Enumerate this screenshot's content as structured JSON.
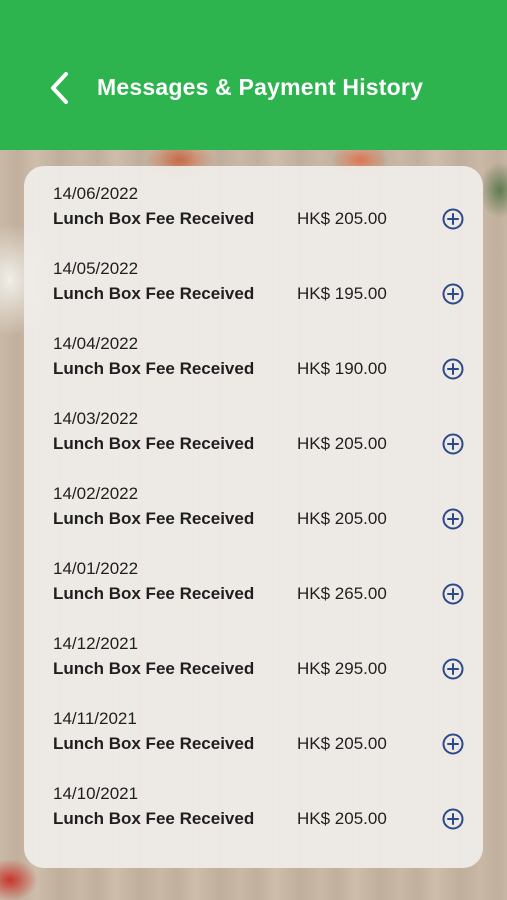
{
  "header": {
    "title": "Messages & Payment History",
    "back_icon": "chevron-left-icon",
    "color": "#2db44f"
  },
  "payments": [
    {
      "date": "14/06/2022",
      "description": "Lunch Box Fee Received",
      "amount": "HK$ 205.00"
    },
    {
      "date": "14/05/2022",
      "description": "Lunch Box Fee Received",
      "amount": "HK$ 195.00"
    },
    {
      "date": "14/04/2022",
      "description": "Lunch Box Fee Received",
      "amount": "HK$ 190.00"
    },
    {
      "date": "14/03/2022",
      "description": "Lunch Box Fee Received",
      "amount": "HK$ 205.00"
    },
    {
      "date": "14/02/2022",
      "description": "Lunch Box Fee Received",
      "amount": "HK$ 205.00"
    },
    {
      "date": "14/01/2022",
      "description": "Lunch Box Fee Received",
      "amount": "HK$ 265.00"
    },
    {
      "date": "14/12/2021",
      "description": "Lunch Box Fee Received",
      "amount": "HK$ 295.00"
    },
    {
      "date": "14/11/2021",
      "description": "Lunch Box Fee Received",
      "amount": "HK$ 205.00"
    },
    {
      "date": "14/10/2021",
      "description": "Lunch Box Fee Received",
      "amount": "HK$ 205.00"
    }
  ],
  "expand_icon": "plus-circle-icon",
  "icon_color": "#2c4a8a"
}
